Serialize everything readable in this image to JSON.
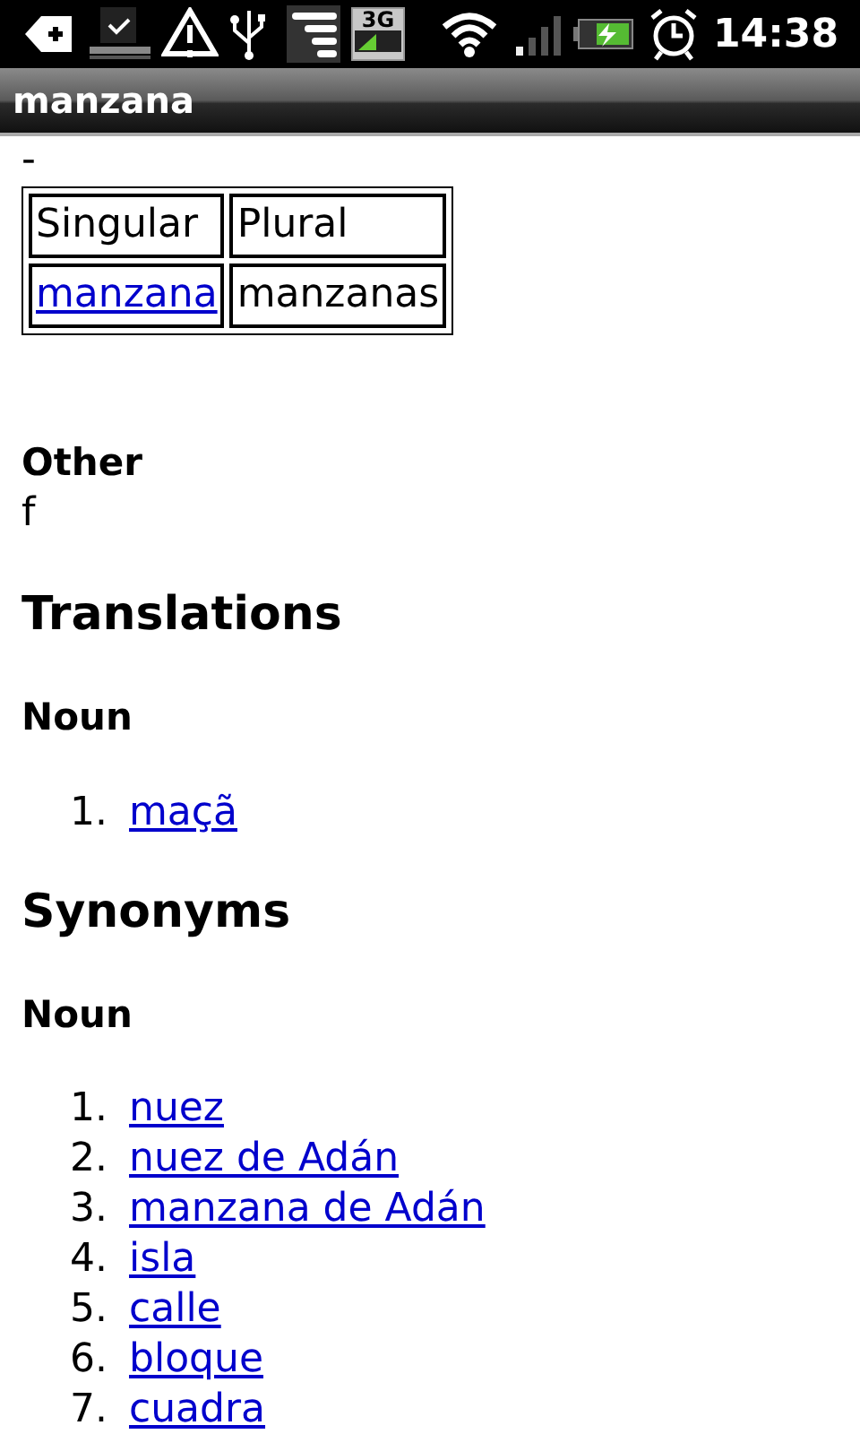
{
  "status_bar": {
    "network": "3G",
    "time": "14:38"
  },
  "title_bar": {
    "title": "manzana"
  },
  "page": {
    "dash": "-",
    "table": {
      "header": [
        "Singular",
        "Plural"
      ],
      "rows": [
        [
          {
            "text": "manzana",
            "kind": "link"
          },
          {
            "text": "manzanas",
            "kind": "plain"
          }
        ]
      ]
    },
    "other": {
      "heading": "Other",
      "value": "f"
    },
    "sections": [
      {
        "heading": "Translations",
        "subheading": "Noun",
        "items": [
          {
            "number": "1.",
            "text": "maçã"
          }
        ]
      },
      {
        "heading": "Synonyms",
        "subheading": "Noun",
        "items": [
          {
            "number": "1.",
            "text": "nuez"
          },
          {
            "number": "2.",
            "text": "nuez de Adán"
          },
          {
            "number": "3.",
            "text": "manzana de Adán"
          },
          {
            "number": "4.",
            "text": "isla"
          },
          {
            "number": "5.",
            "text": "calle"
          },
          {
            "number": "6.",
            "text": "bloque"
          },
          {
            "number": "7.",
            "text": "cuadra"
          }
        ]
      }
    ]
  }
}
